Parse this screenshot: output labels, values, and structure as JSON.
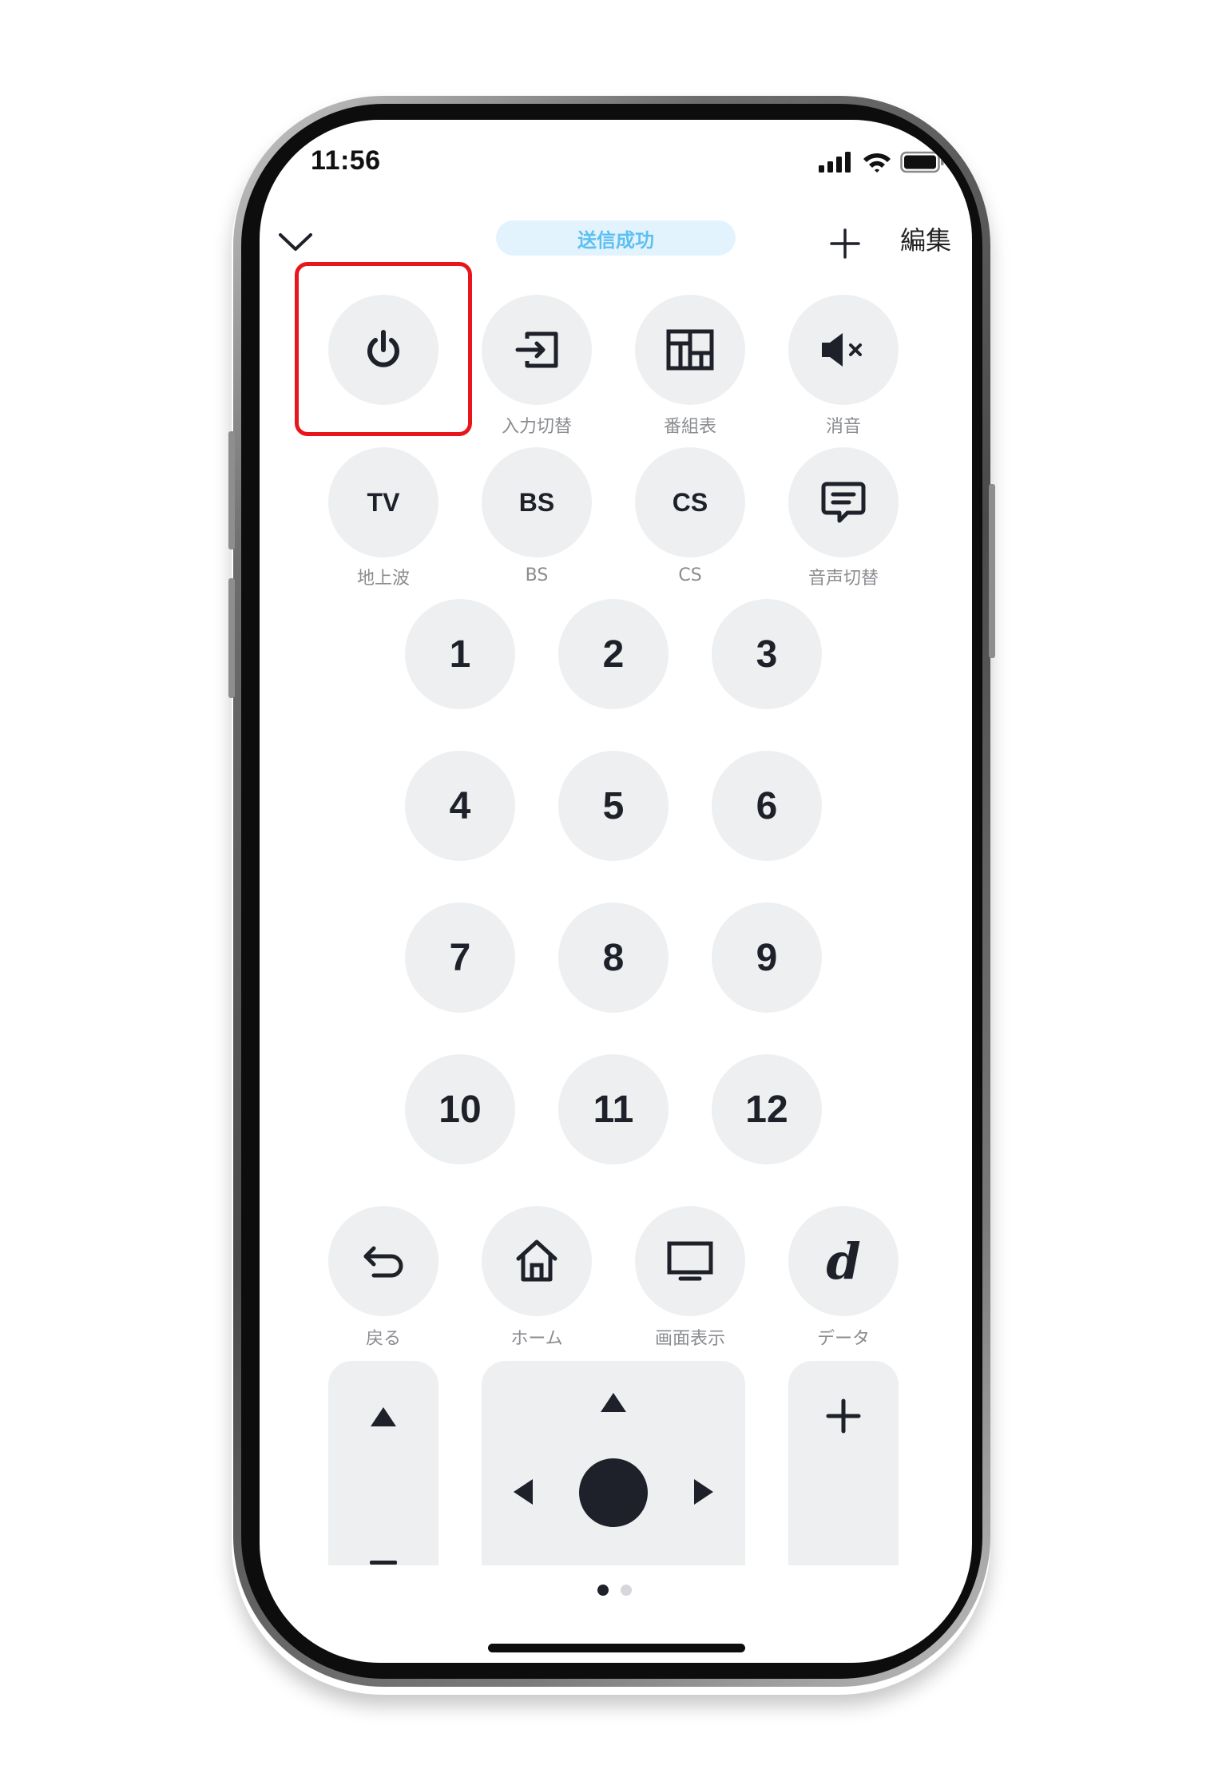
{
  "status_bar": {
    "time": "11:56"
  },
  "header": {
    "toast": "送信成功",
    "edit_label": "編集",
    "collapse_icon": "chevron-down-icon",
    "add_icon": "plus-icon"
  },
  "function_buttons": [
    {
      "id": "power",
      "icon": "power-icon",
      "label": ""
    },
    {
      "id": "input",
      "icon": "input-switch-icon",
      "label": "入力切替"
    },
    {
      "id": "guide",
      "icon": "program-guide-icon",
      "label": "番組表"
    },
    {
      "id": "mute",
      "icon": "mute-icon",
      "label": "消音"
    }
  ],
  "broadcast_buttons": [
    {
      "id": "tv",
      "text": "TV",
      "label": "地上波"
    },
    {
      "id": "bs",
      "text": "BS",
      "label": "BS"
    },
    {
      "id": "cs",
      "text": "CS",
      "label": "CS"
    },
    {
      "id": "audio",
      "icon": "audio-switch-icon",
      "label": "音声切替"
    }
  ],
  "number_buttons": [
    "1",
    "2",
    "3",
    "4",
    "5",
    "6",
    "7",
    "8",
    "9",
    "10",
    "11",
    "12"
  ],
  "nav_buttons": [
    {
      "id": "back",
      "icon": "back-icon",
      "label": "戻る"
    },
    {
      "id": "home",
      "icon": "home-icon",
      "label": "ホーム"
    },
    {
      "id": "display",
      "icon": "screen-display-icon",
      "label": "画面表示"
    },
    {
      "id": "data",
      "text": "d",
      "label": "データ"
    }
  ],
  "pads": {
    "channel_up_icon": "triangle-up-icon",
    "channel_down_icon": "minus-icon",
    "dpad_icons": [
      "triangle-up-icon",
      "triangle-left-icon",
      "circle-ok-icon",
      "triangle-right-icon"
    ],
    "volume_up_icon": "plus-icon"
  },
  "pagination": {
    "pages": 2,
    "current": 1
  },
  "colors": {
    "button_bg": "#eeeff1",
    "icon": "#1e2129",
    "label": "#8a8c90",
    "toast_bg": "#e3f3fd",
    "toast_text": "#5cc0f2",
    "highlight": "#e8161c"
  }
}
